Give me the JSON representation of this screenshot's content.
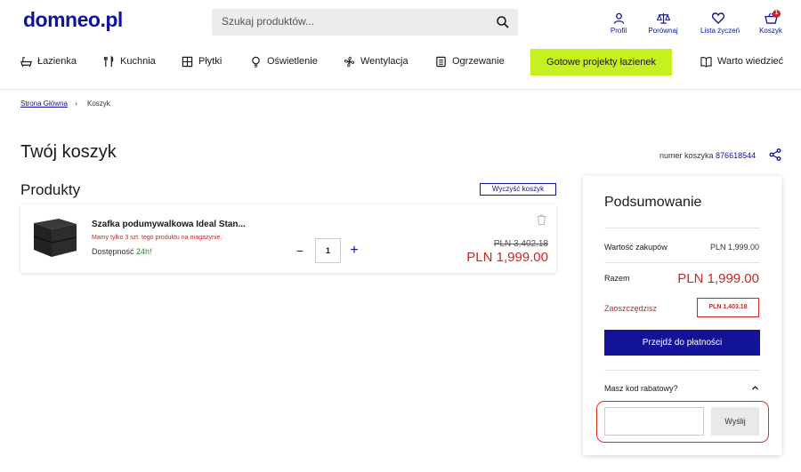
{
  "header": {
    "logo": "domneo.pl",
    "search_placeholder": "Szukaj produktów...",
    "icons": {
      "profile": "Profil",
      "compare": "Porównaj",
      "wishlist": "Lista życzeń",
      "cart": "Koszyk",
      "cart_count": "1"
    }
  },
  "nav": {
    "items": [
      "Łazienka",
      "Kuchnia",
      "Płytki",
      "Oświetlenie",
      "Wentylacja",
      "Ogrzewanie"
    ],
    "promo": "Gotowe projekty łazienek",
    "knowledge": "Warto wiedzieć"
  },
  "breadcrumb": {
    "home": "Strona Główna",
    "current": "Koszyk"
  },
  "page": {
    "title": "Twój koszyk",
    "basket_label": "numer koszyka",
    "basket_number": "876618544"
  },
  "products": {
    "title": "Produkty",
    "clear_label": "Wyczyść koszyk",
    "items": [
      {
        "name": "Szafka podumywalkowa Ideal Stan...",
        "warning": "Mamy tylko 3 szt. tego produktu na magazynie.",
        "availability_label": "Dostępność",
        "availability_value": "24h!",
        "quantity": "1",
        "old_price": "PLN 3,402.18",
        "price": "PLN 1,999.00"
      }
    ]
  },
  "summary": {
    "title": "Podsumowanie",
    "purchase_label": "Wartość zakupów",
    "purchase_value": "PLN 1,999.00",
    "total_label": "Razem",
    "total_value": "PLN 1,999.00",
    "savings_label": "Zaoszczędzisz",
    "savings_value": "PLN 1,403.18",
    "pay_button": "Przejdź do płatności",
    "discount_label": "Masz kod rabatowy?",
    "discount_input_value": "",
    "send_button": "Wyślij"
  },
  "colors": {
    "brand": "#13139a",
    "accent": "#c6f01f",
    "price": "#c62828"
  }
}
